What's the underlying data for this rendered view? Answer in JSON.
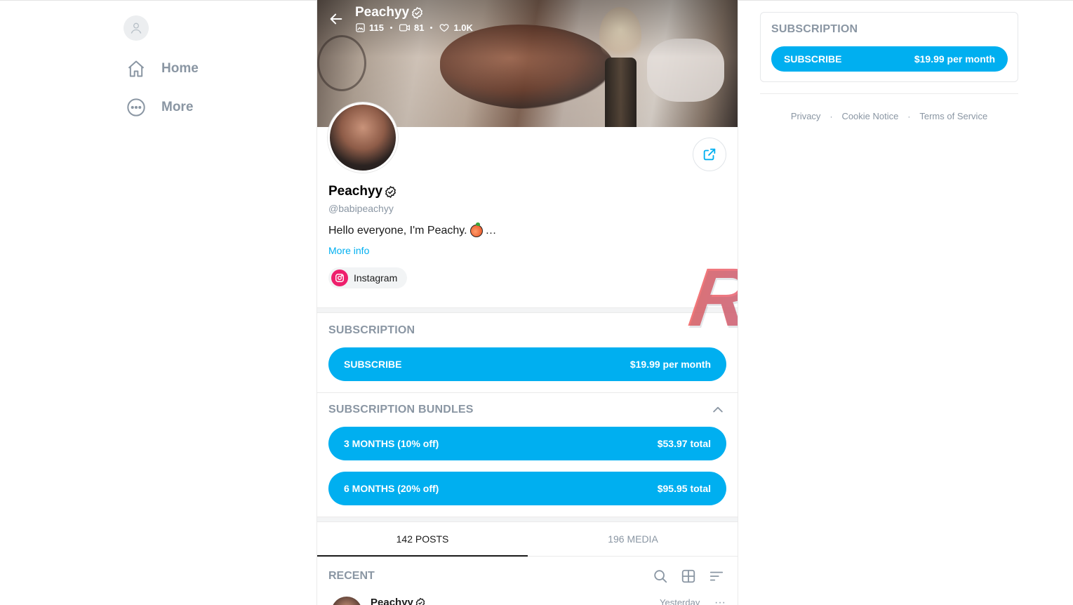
{
  "nav": {
    "items": [
      {
        "label": "Home",
        "icon": "home-icon"
      },
      {
        "label": "More",
        "icon": "more-icon"
      }
    ]
  },
  "cover": {
    "name": "Peachyy",
    "stats": {
      "photos": "115",
      "videos": "81",
      "likes": "1.0K"
    }
  },
  "profile": {
    "name": "Peachyy",
    "handle": "@babipeachyy",
    "bio": "Hello everyone, I'm Peachy.",
    "bio_ellipsis": "…",
    "more_info": "More info",
    "social": "Instagram"
  },
  "subscription": {
    "title": "SUBSCRIPTION",
    "button_label": "SUBSCRIBE",
    "price": "$19.99 per month"
  },
  "bundles": {
    "title": "SUBSCRIPTION BUNDLES",
    "items": [
      {
        "label": "3 MONTHS (10% off)",
        "price": "$53.97 total"
      },
      {
        "label": "6 MONTHS (20% off)",
        "price": "$95.95 total"
      }
    ]
  },
  "tabs": [
    {
      "label": "142 POSTS",
      "active": true
    },
    {
      "label": "196 MEDIA",
      "active": false
    }
  ],
  "recent": {
    "title": "RECENT",
    "post": {
      "name": "Peachyy",
      "date": "Yesterday",
      "more": "···"
    }
  },
  "sidebar": {
    "subscription_title": "SUBSCRIPTION",
    "button_label": "SUBSCRIBE",
    "price": "$19.99 per month"
  },
  "footer": {
    "links": [
      "Privacy",
      "Cookie Notice",
      "Terms of Service"
    ],
    "separator": "·"
  },
  "watermark": "Rphang",
  "colors": {
    "accent": "#00aff0",
    "muted": "#8a96a3",
    "instagram": "#ee1f6c"
  }
}
